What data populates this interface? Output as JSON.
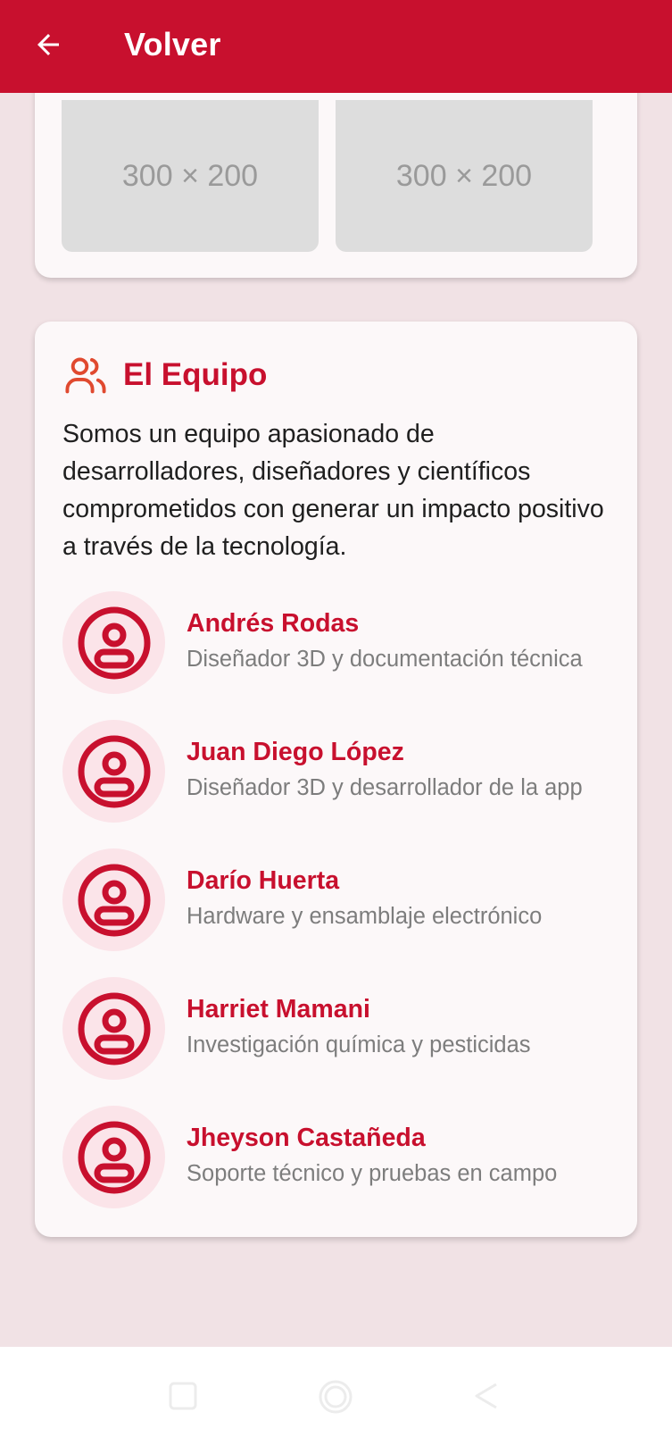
{
  "header": {
    "back_icon": "arrow-left-icon",
    "title": "Volver",
    "color": "#c8102e"
  },
  "gallery": {
    "images": [
      {
        "label": "300 × 200"
      },
      {
        "label": "300 × 200"
      }
    ]
  },
  "team": {
    "icon": "users-icon",
    "title": "El Equipo",
    "description": "Somos un equipo apasionado de desarrolladores, diseñadores y científicos comprometidos con generar un impacto positivo a través de la tecnología.",
    "members": [
      {
        "name": "Andrés Rodas",
        "role": "Diseñador 3D y documentación técnica"
      },
      {
        "name": "Juan Diego López",
        "role": "Diseñador 3D y desarrollador de la app"
      },
      {
        "name": "Darío Huerta",
        "role": "Hardware y ensamblaje electrónico"
      },
      {
        "name": "Harriet Mamani",
        "role": "Investigación química y pesticidas"
      },
      {
        "name": "Jheyson Castañeda",
        "role": "Soporte técnico y pruebas en campo"
      }
    ]
  },
  "navbar": {
    "buttons": [
      "recents-icon",
      "home-icon",
      "back-triangle-icon"
    ]
  }
}
